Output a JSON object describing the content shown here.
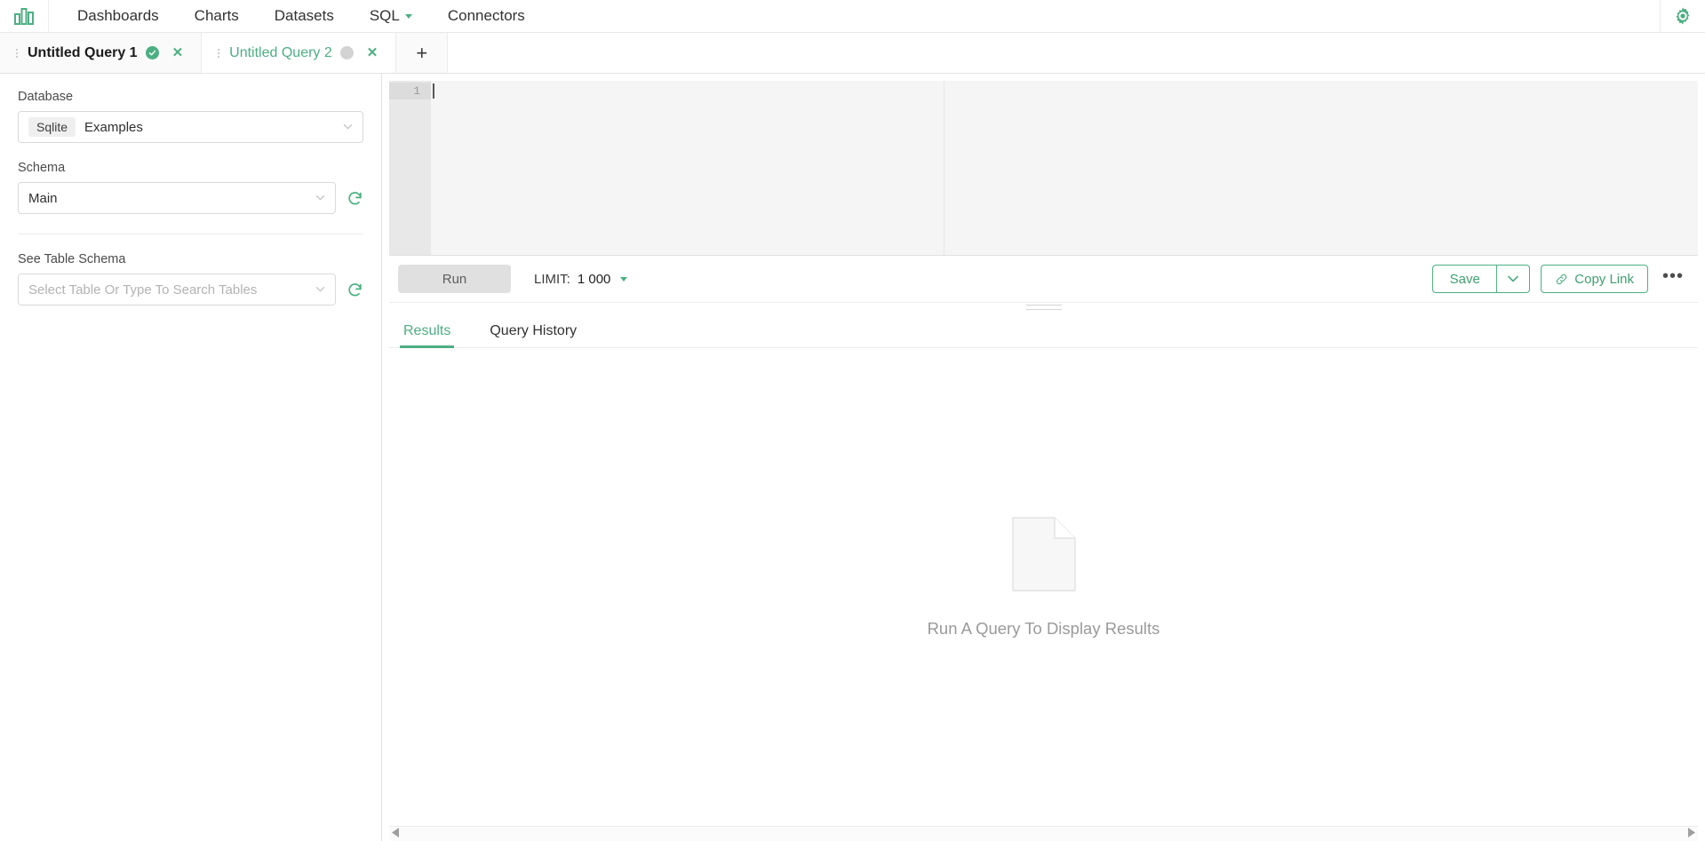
{
  "nav": {
    "logo_icon": "bar-chart-logo",
    "links": [
      {
        "label": "Dashboards",
        "has_caret": false
      },
      {
        "label": "Charts",
        "has_caret": false
      },
      {
        "label": "Datasets",
        "has_caret": false
      },
      {
        "label": "SQL",
        "has_caret": true
      },
      {
        "label": "Connectors",
        "has_caret": false
      }
    ],
    "settings_icon": "gear-icon"
  },
  "tabs": {
    "items": [
      {
        "title": "Untitled Query 1",
        "state": "success",
        "active": false,
        "close_label": "✕"
      },
      {
        "title": "Untitled Query 2",
        "state": "idle",
        "active": true,
        "close_label": "✕"
      }
    ],
    "add_label": "+"
  },
  "sidebar": {
    "database": {
      "label": "Database",
      "engine_pill": "Sqlite",
      "value": "Examples",
      "chevron": "⌄"
    },
    "schema": {
      "label": "Schema",
      "value": "Main",
      "chevron": "⌄",
      "refresh_icon": "refresh-icon"
    },
    "table_schema": {
      "label": "See Table Schema",
      "placeholder": "Select Table Or Type To Search Tables",
      "value": "",
      "chevron": "⌄",
      "refresh_icon": "refresh-icon"
    }
  },
  "editor": {
    "line_numbers": [
      "1"
    ],
    "content": "",
    "placeholder": ""
  },
  "toolbar": {
    "run_label": "Run",
    "limit_label": "LIMIT:",
    "limit_value": "1 000",
    "save_label": "Save",
    "save_caret_icon": "chevron-down-icon",
    "copy_link_label": "Copy Link",
    "copy_link_icon": "link-icon",
    "more_label": "•••"
  },
  "results": {
    "tabs": [
      {
        "label": "Results",
        "active": true
      },
      {
        "label": "Query History",
        "active": false
      }
    ],
    "empty_icon": "document-icon",
    "empty_message": "Run A Query To Display Results"
  },
  "scrollbar": {
    "left_arrow": "scroll-left-arrow",
    "right_arrow": "scroll-right-arrow"
  },
  "colors": {
    "accent": "#4caf82",
    "text": "#323232",
    "muted": "#9a9a9a",
    "border": "#e0e0e0",
    "editor_bg": "#f5f5f5",
    "gutter_bg": "#e8e8e8"
  }
}
